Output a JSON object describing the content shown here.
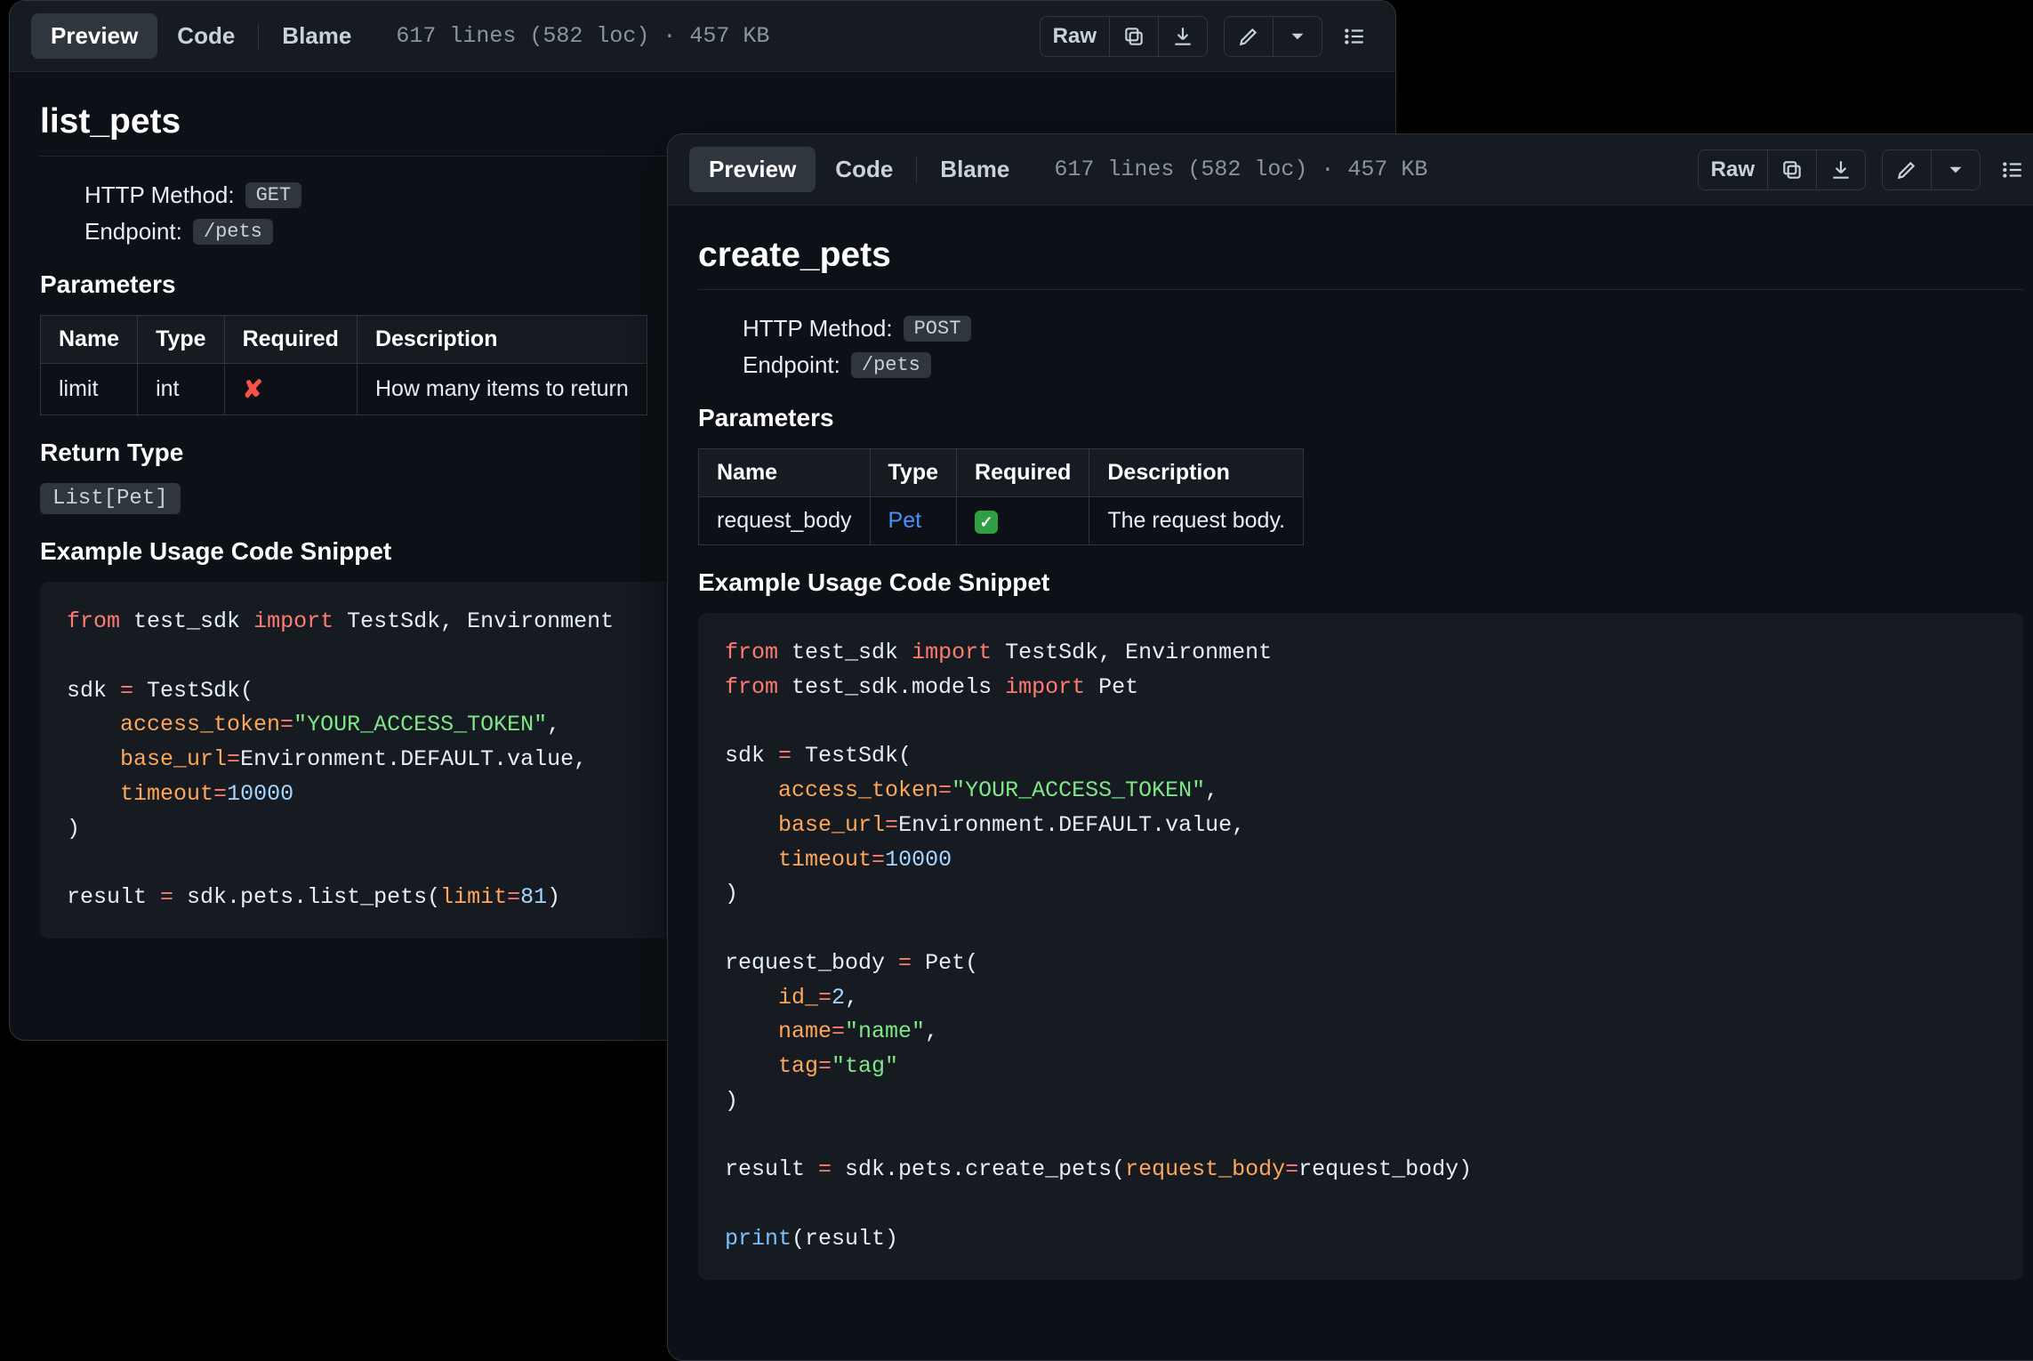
{
  "toolbar": {
    "tabs": {
      "preview": "Preview",
      "code": "Code",
      "blame": "Blame"
    },
    "meta": "617 lines (582 loc) · 457 KB",
    "raw": "Raw"
  },
  "panels": {
    "list_pets": {
      "title": "list_pets",
      "method_label": "HTTP Method:",
      "method": "GET",
      "endpoint_label": "Endpoint:",
      "endpoint": "/pets",
      "params_heading": "Parameters",
      "cols": {
        "name": "Name",
        "type": "Type",
        "required": "Required",
        "description": "Description"
      },
      "params": [
        {
          "name": "limit",
          "type": "int",
          "required": false,
          "required_symbol": "✘",
          "description": "How many items to return"
        }
      ],
      "return_heading": "Return Type",
      "return_type": "List[Pet]",
      "snippet_heading": "Example Usage Code Snippet",
      "code": {
        "l1_from": "from",
        "l1_mod": "test_sdk",
        "l1_import": "import",
        "l1_names": "TestSdk, Environment",
        "l2_sdk": "sdk ",
        "l2_eq": "=",
        "l2_call": " TestSdk(",
        "l3_kw": "access_token",
        "l3_eq": "=",
        "l3_str": "\"YOUR_ACCESS_TOKEN\"",
        "l3_comma": ",",
        "l4_kw": "base_url",
        "l4_eq": "=",
        "l4_val": "Environment.DEFAULT.value,",
        "l5_kw": "timeout",
        "l5_eq": "=",
        "l5_num": "10000",
        "close": ")",
        "l6_res": "result ",
        "l6_eq": "=",
        "l6_call1": " sdk.pets.list_pets(",
        "l6_kw": "limit",
        "l6_eq2": "=",
        "l6_num": "81",
        "l6_close": ")"
      }
    },
    "create_pets": {
      "title": "create_pets",
      "method_label": "HTTP Method:",
      "method": "POST",
      "endpoint_label": "Endpoint:",
      "endpoint": "/pets",
      "params_heading": "Parameters",
      "cols": {
        "name": "Name",
        "type": "Type",
        "required": "Required",
        "description": "Description"
      },
      "params": [
        {
          "name": "request_body",
          "type": "Pet",
          "required": true,
          "required_symbol": "✓",
          "description": "The request body."
        }
      ],
      "snippet_heading": "Example Usage Code Snippet",
      "code": {
        "l1_from": "from",
        "l1_mod": "test_sdk",
        "l1_import": "import",
        "l1_names": "TestSdk, Environment",
        "l2_from": "from",
        "l2_mod": "test_sdk.models",
        "l2_import": "import",
        "l2_names": "Pet",
        "sdk_assign": "sdk ",
        "sdk_eq": "=",
        "sdk_call": " TestSdk(",
        "at_kw": "access_token",
        "at_eq": "=",
        "at_str": "\"YOUR_ACCESS_TOKEN\"",
        "at_comma": ",",
        "bu_kw": "base_url",
        "bu_eq": "=",
        "bu_val": "Environment.DEFAULT.value,",
        "to_kw": "timeout",
        "to_eq": "=",
        "to_num": "10000",
        "close1": ")",
        "rb_assign": "request_body ",
        "rb_eq": "=",
        "rb_call": " Pet(",
        "id_kw": "id_",
        "id_eq": "=",
        "id_num": "2",
        "id_comma": ",",
        "name_kw": "name",
        "name_eq": "=",
        "name_str": "\"name\"",
        "name_comma": ",",
        "tag_kw": "tag",
        "tag_eq": "=",
        "tag_str": "\"tag\"",
        "close2": ")",
        "res_assign": "result ",
        "res_eq": "=",
        "res_call1": " sdk.pets.create_pets(",
        "res_kw": "request_body",
        "res_eq2": "=",
        "res_arg": "request_body)",
        "print": "print",
        "print_arg": "(result)"
      }
    }
  }
}
